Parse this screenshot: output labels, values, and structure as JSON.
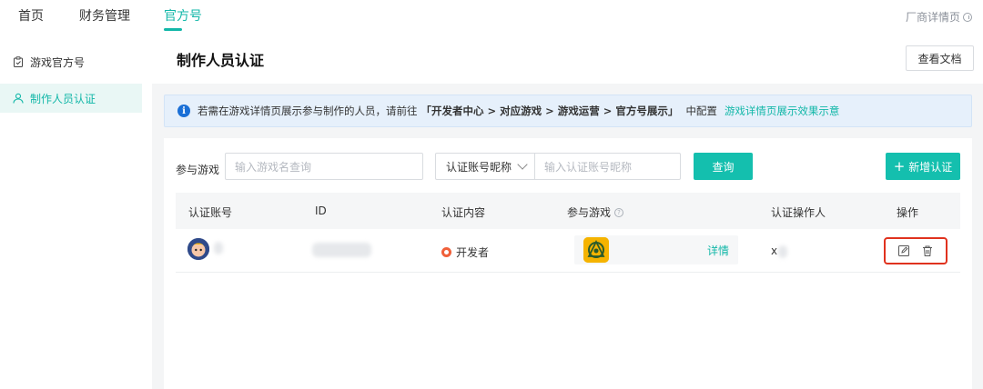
{
  "topnav": {
    "tabs": [
      {
        "label": "首页",
        "active": false
      },
      {
        "label": "财务管理",
        "active": false
      },
      {
        "label": "官方号",
        "active": true
      }
    ],
    "right_link": "厂商详情页",
    "accent_color": "#12b7a8"
  },
  "sidebar": {
    "items": [
      {
        "label": "游戏官方号",
        "icon": "clipboard-icon",
        "active": false
      },
      {
        "label": "制作人员认证",
        "icon": "user-icon",
        "active": true
      }
    ]
  },
  "main": {
    "title": "制作人员认证",
    "doc_button": "查看文档",
    "notice": {
      "text": "若需在游戏详情页展示参与制作的人员，请前往",
      "path": "「开发者中心 > 对应游戏 > 游戏运营 > 官方号展示」",
      "suffix": "中配置",
      "link": "游戏详情页展示效果示意"
    },
    "filter": {
      "game_label": "参与游戏",
      "game_placeholder": "输入游戏名查询",
      "select_value": "认证账号昵称",
      "account_placeholder": "输入认证账号昵称",
      "search_button": "查询",
      "add_button": "新增认证"
    },
    "table": {
      "columns": [
        "认证账号",
        "ID",
        "认证内容",
        "参与游戏",
        "认证操作人",
        "操作"
      ],
      "rows": [
        {
          "account": "",
          "id": "",
          "content": "开发者",
          "game_action": "详情",
          "operator": "x"
        }
      ]
    }
  }
}
